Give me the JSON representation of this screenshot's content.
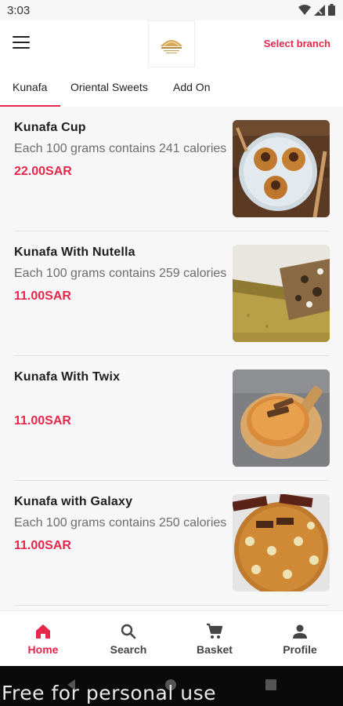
{
  "status_bar": {
    "time": "3:03"
  },
  "header": {
    "select_branch": "Select branch"
  },
  "tabs": [
    {
      "label": "Kunafa",
      "active": true
    },
    {
      "label": "Oriental Sweets",
      "active": false
    },
    {
      "label": "Add On",
      "active": false
    }
  ],
  "products": [
    {
      "name": "Kunafa Cup",
      "description": "Each 100 grams contains 241 calories",
      "price": "22.00SAR",
      "image": "kunafa-cups-on-plate"
    },
    {
      "name": "Kunafa With Nutella",
      "description": "Each 100 grams contains 259 calories",
      "price": "11.00SAR",
      "image": "kunafa-nutella-slice"
    },
    {
      "name": "Kunafa With Twix",
      "description": "",
      "price": "11.00SAR",
      "image": "kunafa-twix-cake"
    },
    {
      "name": "Kunafa with Galaxy",
      "description": "Each 100 grams contains 250 calories",
      "price": "11.00SAR",
      "image": "kunafa-galaxy-cake"
    }
  ],
  "bottom_nav": [
    {
      "label": "Home",
      "icon": "home-icon",
      "active": true
    },
    {
      "label": "Search",
      "icon": "search-icon",
      "active": false
    },
    {
      "label": "Basket",
      "icon": "cart-icon",
      "active": false
    },
    {
      "label": "Profile",
      "icon": "person-icon",
      "active": false
    }
  ],
  "watermark": "Free for personal use",
  "colors": {
    "accent": "#e4274b",
    "background": "#f7f7f7",
    "surface": "#ffffff"
  }
}
